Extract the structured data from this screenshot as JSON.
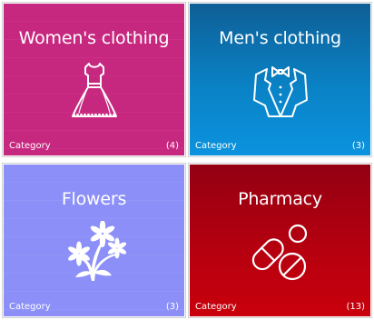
{
  "tiles": [
    {
      "title": "Women's clothing",
      "label": "Category",
      "count": "(4)",
      "icon": "dress-icon",
      "color": "#c7287f"
    },
    {
      "title": "Men's clothing",
      "label": "Category",
      "count": "(3)",
      "icon": "tuxedo-icon",
      "color": "#0a82c6"
    },
    {
      "title": "Flowers",
      "label": "Category",
      "count": "(3)",
      "icon": "flowers-icon",
      "color": "#8b8ff7"
    },
    {
      "title": "Pharmacy",
      "label": "Category",
      "count": "(13)",
      "icon": "pills-icon",
      "color": "#b5000f"
    }
  ]
}
